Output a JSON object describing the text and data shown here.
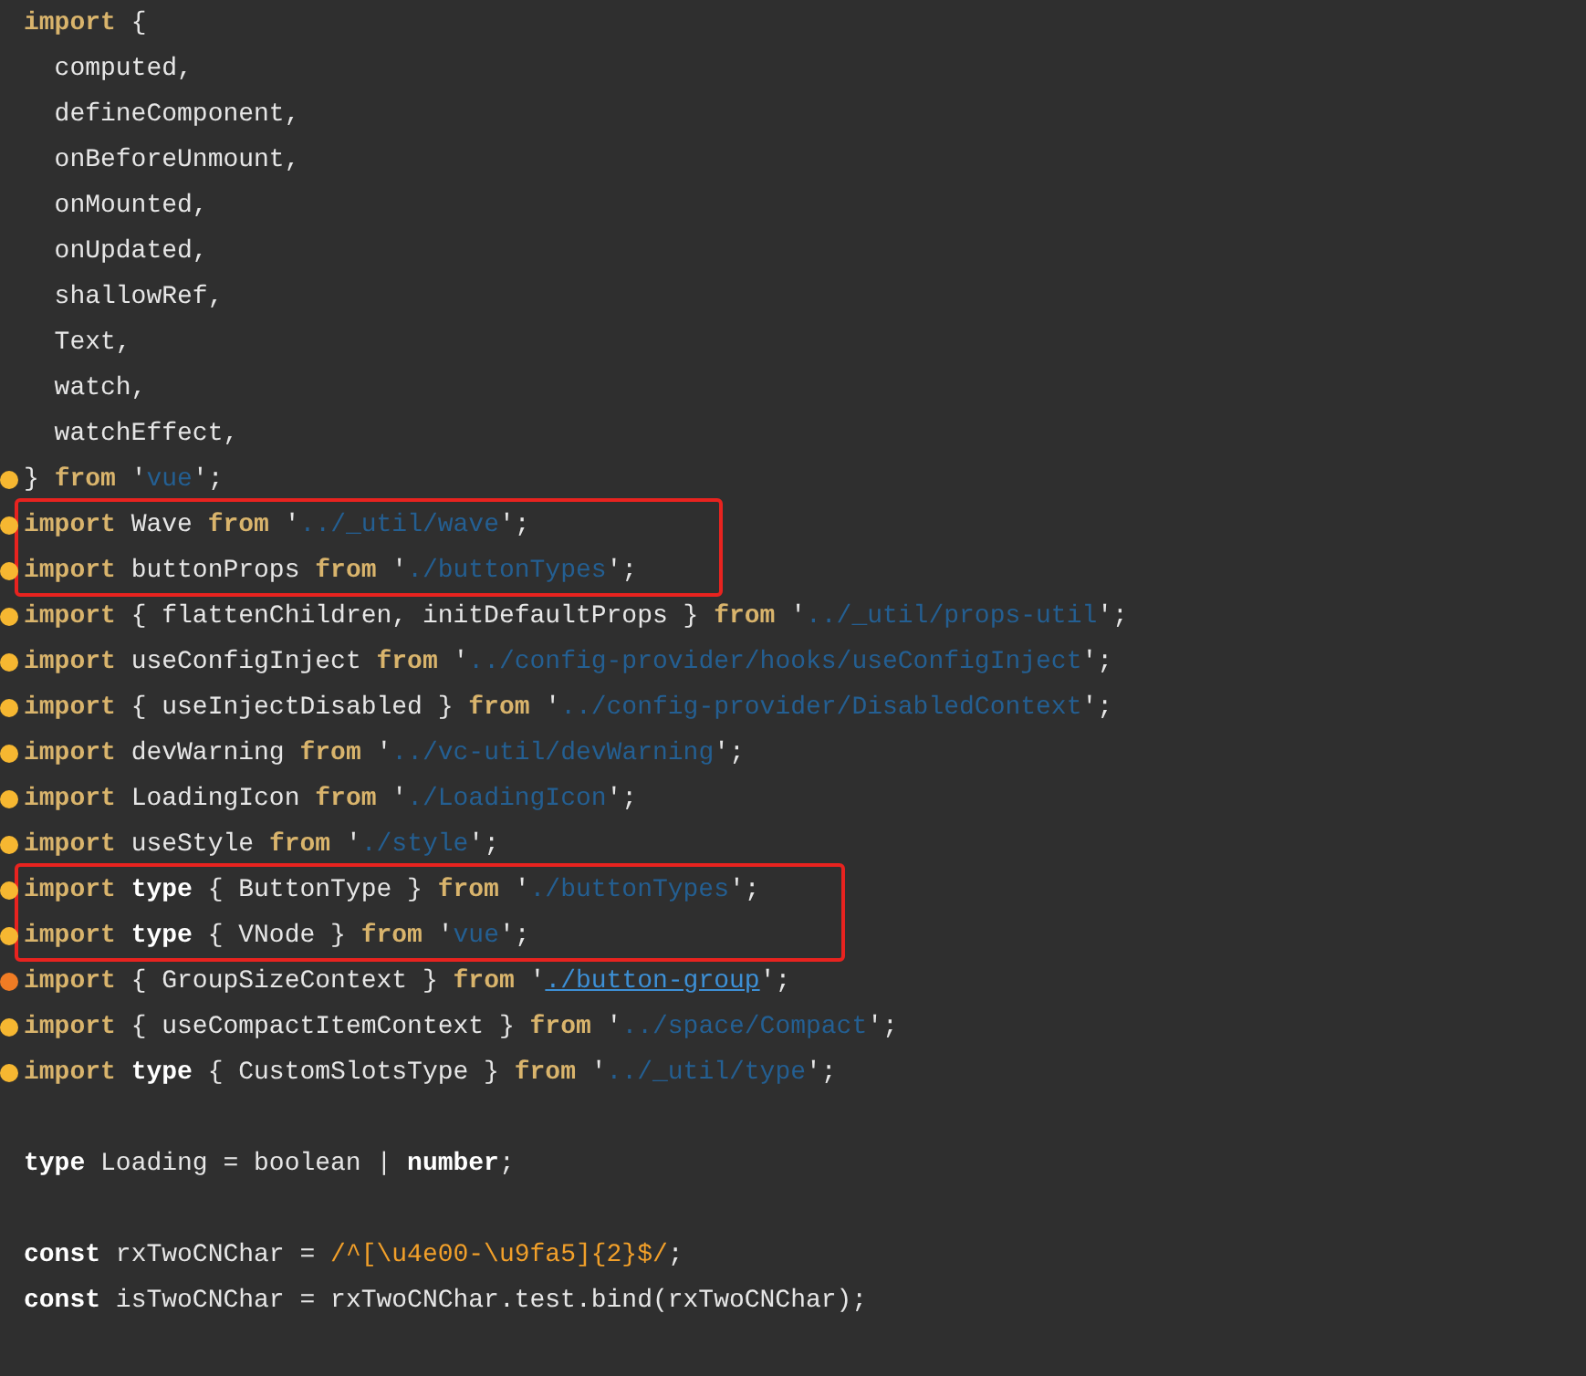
{
  "blocks": [
    {
      "kind": "plain",
      "lines": [
        {
          "kind": "code",
          "tokens": [
            {
              "kind": "keyword",
              "text": "import"
            },
            {
              "kind": "plain",
              "text": " {"
            }
          ]
        },
        {
          "kind": "code",
          "tokens": [
            {
              "kind": "plain",
              "text": "  computed,"
            }
          ]
        },
        {
          "kind": "code",
          "tokens": [
            {
              "kind": "plain",
              "text": "  defineComponent,"
            }
          ]
        },
        {
          "kind": "code",
          "tokens": [
            {
              "kind": "plain",
              "text": "  onBeforeUnmount,"
            }
          ]
        },
        {
          "kind": "code",
          "tokens": [
            {
              "kind": "plain",
              "text": "  onMounted,"
            }
          ]
        },
        {
          "kind": "code",
          "tokens": [
            {
              "kind": "plain",
              "text": "  onUpdated,"
            }
          ]
        },
        {
          "kind": "code",
          "tokens": [
            {
              "kind": "plain",
              "text": "  shallowRef,"
            }
          ]
        },
        {
          "kind": "code",
          "tokens": [
            {
              "kind": "plain",
              "text": "  Text,"
            }
          ]
        },
        {
          "kind": "code",
          "tokens": [
            {
              "kind": "plain",
              "text": "  watch,"
            }
          ]
        },
        {
          "kind": "code",
          "tokens": [
            {
              "kind": "plain",
              "text": "  watchEffect,"
            }
          ]
        },
        {
          "kind": "code",
          "color": "#f6b731",
          "tokens": [
            {
              "kind": "plain",
              "text": "} "
            },
            {
              "kind": "keyword",
              "text": "from"
            },
            {
              "kind": "plain",
              "text": " '"
            },
            {
              "kind": "string",
              "text": "vue"
            },
            {
              "kind": "plain",
              "text": "';"
            }
          ]
        }
      ]
    },
    {
      "kind": "boxed",
      "lines": [
        {
          "kind": "code",
          "color": "#f6b731",
          "tokens": [
            {
              "kind": "keyword",
              "text": "import"
            },
            {
              "kind": "plain",
              "text": " Wave "
            },
            {
              "kind": "keyword",
              "text": "from"
            },
            {
              "kind": "plain",
              "text": " '"
            },
            {
              "kind": "string",
              "text": "../_util/wave"
            },
            {
              "kind": "plain",
              "text": "';"
            }
          ]
        },
        {
          "kind": "code",
          "color": "#f6b731",
          "tokens": [
            {
              "kind": "keyword",
              "text": "import"
            },
            {
              "kind": "plain",
              "text": " buttonProps "
            },
            {
              "kind": "keyword",
              "text": "from"
            },
            {
              "kind": "plain",
              "text": " '"
            },
            {
              "kind": "string",
              "text": "./buttonTypes"
            },
            {
              "kind": "plain",
              "text": "';"
            }
          ]
        }
      ]
    },
    {
      "kind": "plain",
      "lines": [
        {
          "kind": "code",
          "color": "#f6b731",
          "tokens": [
            {
              "kind": "keyword",
              "text": "import"
            },
            {
              "kind": "plain",
              "text": " { flattenChildren, initDefaultProps } "
            },
            {
              "kind": "keyword",
              "text": "from"
            },
            {
              "kind": "plain",
              "text": " '"
            },
            {
              "kind": "string",
              "text": "../_util/props-util"
            },
            {
              "kind": "plain",
              "text": "';"
            }
          ]
        },
        {
          "kind": "code",
          "color": "#f6b731",
          "tokens": [
            {
              "kind": "keyword",
              "text": "import"
            },
            {
              "kind": "plain",
              "text": " useConfigInject "
            },
            {
              "kind": "keyword",
              "text": "from"
            },
            {
              "kind": "plain",
              "text": " '"
            },
            {
              "kind": "string",
              "text": "../config-provider/hooks/useConfigInject"
            },
            {
              "kind": "plain",
              "text": "';"
            }
          ]
        },
        {
          "kind": "code",
          "color": "#f6b731",
          "tokens": [
            {
              "kind": "keyword",
              "text": "import"
            },
            {
              "kind": "plain",
              "text": " { useInjectDisabled } "
            },
            {
              "kind": "keyword",
              "text": "from"
            },
            {
              "kind": "plain",
              "text": " '"
            },
            {
              "kind": "string",
              "text": "../config-provider/DisabledContext"
            },
            {
              "kind": "plain",
              "text": "';"
            }
          ]
        },
        {
          "kind": "code",
          "color": "#f6b731",
          "tokens": [
            {
              "kind": "keyword",
              "text": "import"
            },
            {
              "kind": "plain",
              "text": " devWarning "
            },
            {
              "kind": "keyword",
              "text": "from"
            },
            {
              "kind": "plain",
              "text": " '"
            },
            {
              "kind": "string",
              "text": "../vc-util/devWarning"
            },
            {
              "kind": "plain",
              "text": "';"
            }
          ]
        },
        {
          "kind": "code",
          "color": "#f6b731",
          "tokens": [
            {
              "kind": "keyword",
              "text": "import"
            },
            {
              "kind": "plain",
              "text": " LoadingIcon "
            },
            {
              "kind": "keyword",
              "text": "from"
            },
            {
              "kind": "plain",
              "text": " '"
            },
            {
              "kind": "string",
              "text": "./LoadingIcon"
            },
            {
              "kind": "plain",
              "text": "';"
            }
          ]
        },
        {
          "kind": "code",
          "color": "#f6b731",
          "tokens": [
            {
              "kind": "keyword",
              "text": "import"
            },
            {
              "kind": "plain",
              "text": " useStyle "
            },
            {
              "kind": "keyword",
              "text": "from"
            },
            {
              "kind": "plain",
              "text": " '"
            },
            {
              "kind": "string",
              "text": "./style"
            },
            {
              "kind": "plain",
              "text": "';"
            }
          ]
        }
      ]
    },
    {
      "kind": "boxed",
      "lines": [
        {
          "kind": "code",
          "color": "#f6b731",
          "tokens": [
            {
              "kind": "keyword",
              "text": "import "
            },
            {
              "kind": "bold",
              "text": "type"
            },
            {
              "kind": "plain",
              "text": " { ButtonType } "
            },
            {
              "kind": "keyword",
              "text": "from"
            },
            {
              "kind": "plain",
              "text": " '"
            },
            {
              "kind": "string",
              "text": "./buttonTypes"
            },
            {
              "kind": "plain",
              "text": "';"
            }
          ]
        },
        {
          "kind": "code",
          "color": "#f6b731",
          "tokens": [
            {
              "kind": "keyword",
              "text": "import "
            },
            {
              "kind": "bold",
              "text": "type"
            },
            {
              "kind": "plain",
              "text": " { VNode } "
            },
            {
              "kind": "keyword",
              "text": "from"
            },
            {
              "kind": "plain",
              "text": " '"
            },
            {
              "kind": "string",
              "text": "vue"
            },
            {
              "kind": "plain",
              "text": "';"
            }
          ]
        }
      ]
    },
    {
      "kind": "plain",
      "lines": [
        {
          "kind": "code",
          "color": "#f07c24",
          "tokens": [
            {
              "kind": "keyword",
              "text": "import"
            },
            {
              "kind": "plain",
              "text": " { GroupSizeContext } "
            },
            {
              "kind": "keyword",
              "text": "from"
            },
            {
              "kind": "plain",
              "text": " '"
            },
            {
              "kind": "link",
              "text": "./button-group"
            },
            {
              "kind": "plain",
              "text": "';"
            }
          ]
        },
        {
          "kind": "code",
          "color": "#f6b731",
          "tokens": [
            {
              "kind": "keyword",
              "text": "import"
            },
            {
              "kind": "plain",
              "text": " { useCompactItemContext } "
            },
            {
              "kind": "keyword",
              "text": "from"
            },
            {
              "kind": "plain",
              "text": " '"
            },
            {
              "kind": "string",
              "text": "../space/Compact"
            },
            {
              "kind": "plain",
              "text": "';"
            }
          ]
        },
        {
          "kind": "code",
          "color": "#f6b731",
          "tokens": [
            {
              "kind": "keyword",
              "text": "import "
            },
            {
              "kind": "bold",
              "text": "type"
            },
            {
              "kind": "plain",
              "text": " { CustomSlotsType } "
            },
            {
              "kind": "keyword",
              "text": "from"
            },
            {
              "kind": "plain",
              "text": " '"
            },
            {
              "kind": "string",
              "text": "../_util/type"
            },
            {
              "kind": "plain",
              "text": "';"
            }
          ]
        },
        {
          "kind": "blank"
        },
        {
          "kind": "code",
          "tokens": [
            {
              "kind": "bold",
              "text": "type"
            },
            {
              "kind": "plain",
              "text": " Loading = boolean | "
            },
            {
              "kind": "bold",
              "text": "number"
            },
            {
              "kind": "plain",
              "text": ";"
            }
          ]
        },
        {
          "kind": "blank"
        },
        {
          "kind": "code",
          "tokens": [
            {
              "kind": "bold",
              "text": "const"
            },
            {
              "kind": "plain",
              "text": " rxTwoCNChar = "
            },
            {
              "kind": "regex",
              "text": "/^[\\u4e00-\\u9fa5]{2}$/"
            },
            {
              "kind": "plain",
              "text": ";"
            }
          ]
        },
        {
          "kind": "code",
          "tokens": [
            {
              "kind": "bold",
              "text": "const"
            },
            {
              "kind": "plain",
              "text": " isTwoCNChar = rxTwoCNChar.test.bind(rxTwoCNChar);"
            }
          ]
        }
      ]
    }
  ]
}
